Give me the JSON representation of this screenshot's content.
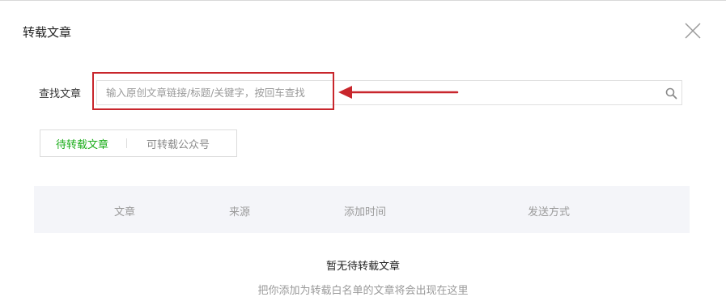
{
  "dialog": {
    "title": "转载文章"
  },
  "search": {
    "label": "查找文章",
    "placeholder": "输入原创文章链接/标题/关键字，按回车查找",
    "value": ""
  },
  "tabs": [
    {
      "label": "待转载文章",
      "active": true
    },
    {
      "label": "可转载公众号",
      "active": false
    }
  ],
  "table": {
    "columns": [
      "文章",
      "来源",
      "添加时间",
      "发送方式"
    ]
  },
  "empty": {
    "title": "暂无待转载文章",
    "description": "把你添加为转载白名单的文章将会出现在这里"
  },
  "colors": {
    "accent": "#1aad19",
    "highlight": "#c8262c",
    "header_bg": "#f4f5f9"
  },
  "icons": {
    "close": "close-icon",
    "search": "search-icon"
  }
}
